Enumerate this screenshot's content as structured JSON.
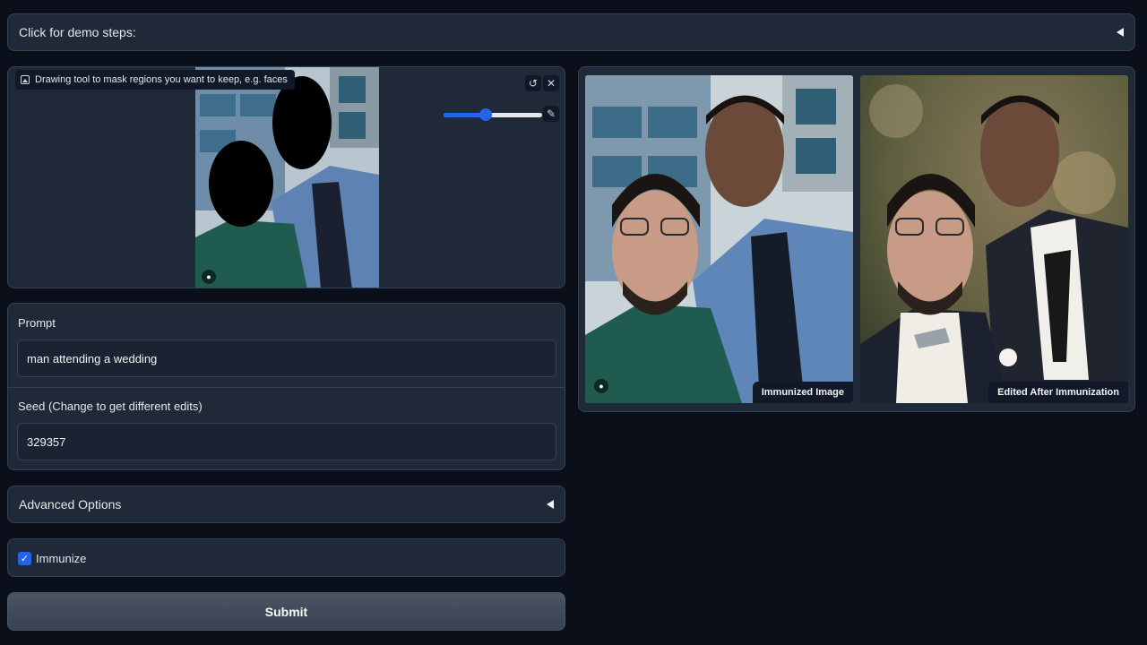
{
  "demo_accordion": {
    "label": "Click for demo steps:"
  },
  "sketch": {
    "label": "Drawing tool to mask regions you want to keep, e.g. faces",
    "brush_size_fraction": 0.43,
    "icons": [
      "undo-icon",
      "close-icon",
      "brush-icon",
      "image-icon",
      "user-icon"
    ]
  },
  "prompt": {
    "label": "Prompt",
    "value": "man attending a wedding"
  },
  "seed": {
    "label": "Seed (Change to get different edits)",
    "value": "329357"
  },
  "advanced": {
    "label": "Advanced Options"
  },
  "immunize": {
    "label": "Immunize",
    "checked": true
  },
  "submit": {
    "label": "Submit"
  },
  "gallery": {
    "items": [
      {
        "caption": "Immunized Image"
      },
      {
        "caption": "Edited After Immunization"
      }
    ]
  },
  "colors": {
    "background": "#0b0f19",
    "panel": "#1f2937",
    "accent": "#2563eb"
  }
}
